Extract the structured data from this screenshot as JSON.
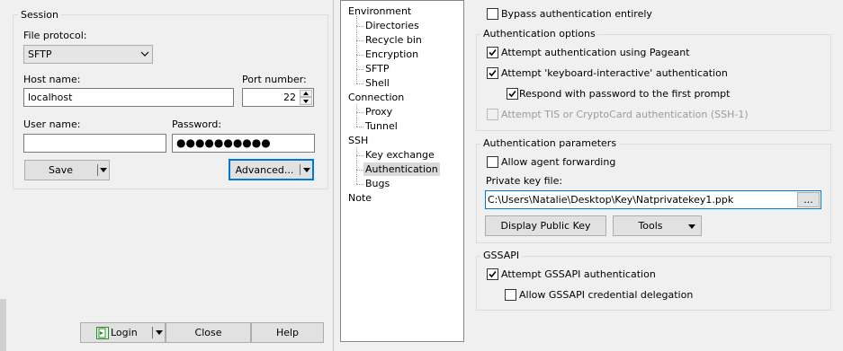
{
  "session": {
    "group_title": "Session",
    "file_protocol_label": "File protocol:",
    "file_protocol_value": "SFTP",
    "host_label": "Host name:",
    "host_value": "localhost",
    "port_label": "Port number:",
    "port_value": "22",
    "user_label": "User name:",
    "user_value": "",
    "password_label": "Password:",
    "password_value": "●●●●●●●●●●",
    "save_button": "Save",
    "advanced_button": "Advanced..."
  },
  "footer": {
    "login_button": "Login",
    "close_button": "Close",
    "help_button": "Help"
  },
  "tree": {
    "environment": "Environment",
    "directories": "Directories",
    "recycle_bin": "Recycle bin",
    "encryption": "Encryption",
    "sftp": "SFTP",
    "shell": "Shell",
    "connection": "Connection",
    "proxy": "Proxy",
    "tunnel": "Tunnel",
    "ssh": "SSH",
    "key_exchange": "Key exchange",
    "authentication": "Authentication",
    "bugs": "Bugs",
    "note": "Note"
  },
  "auth": {
    "bypass_label": "Bypass authentication entirely",
    "bypass_checked": false,
    "options_title": "Authentication options",
    "pageant_label": "Attempt authentication using Pageant",
    "pageant_checked": true,
    "keyboard_label": "Attempt 'keyboard-interactive' authentication",
    "keyboard_checked": true,
    "respond_label": "Respond with password to the first prompt",
    "respond_checked": true,
    "tis_label": "Attempt TIS or CryptoCard authentication (SSH-1)",
    "tis_checked": false,
    "params_title": "Authentication parameters",
    "agent_fwd_label": "Allow agent forwarding",
    "agent_fwd_checked": false,
    "private_key_label": "Private key file:",
    "private_key_value": "C:\\Users\\Natalie\\Desktop\\Key\\Natprivatekey1.ppk",
    "browse_button": "...",
    "display_public_key_button": "Display Public Key",
    "tools_button": "Tools",
    "gssapi_title": "GSSAPI",
    "gssapi_label": "Attempt GSSAPI authentication",
    "gssapi_checked": true,
    "gssapi_deleg_label": "Allow GSSAPI credential delegation",
    "gssapi_deleg_checked": false
  },
  "colors": {
    "focus_border": "#0078d7",
    "login_icon_green": "#2e8b2e"
  }
}
